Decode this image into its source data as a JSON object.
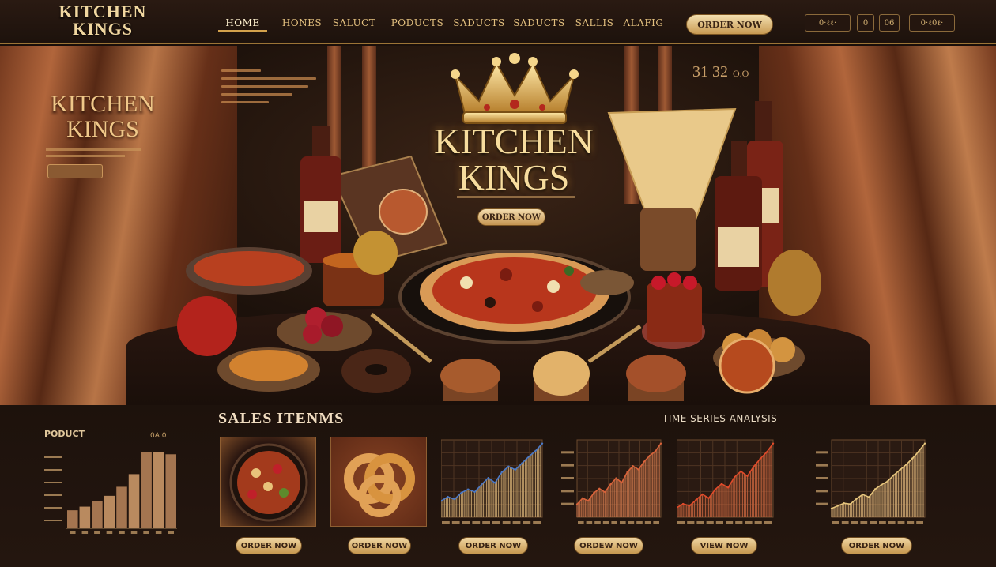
{
  "brand": {
    "logo": "KITCHEN KINGS"
  },
  "nav": {
    "items": [
      "HOME",
      "HONES",
      "SALUCT",
      "PODUCTS",
      "SADUCTS",
      "SADUCTS",
      "SALLIS",
      "ALAFIG"
    ],
    "active_index": 0,
    "order_label": "ORDER NOW"
  },
  "utility": {
    "a": "0·ℓℓ·",
    "b": "0",
    "c": "06",
    "d": "0·ℓ0ℓ·"
  },
  "hero": {
    "left_title": "KITCHEN KINGS",
    "title": "KITCHEN KINGS",
    "order_label": "ORDER NOW",
    "counter": "31 32",
    "counter_unit": "O.O"
  },
  "sales": {
    "heading": "SALES ITENMS",
    "time_series_heading": "TIME SERIES ANALYSIS",
    "product_label": "PODUCT",
    "product_value": "0A 0",
    "buttons": [
      "ORDER NOW",
      "ORDER NOW",
      "ORDER NOW",
      "ORDEW NOW",
      "VIEW NOW",
      "ORDER NOW"
    ]
  },
  "colors": {
    "gold": "#d4a24c",
    "background": "#1a0f0a",
    "accent": "#c6974f"
  },
  "chart_data": [
    {
      "type": "bar",
      "values": [
        1,
        1.2,
        1.5,
        1.8,
        2.3,
        3,
        4.2,
        4.2,
        4.1
      ]
    },
    {
      "type": "area",
      "values": [
        2,
        2.5,
        2.2,
        3,
        3.4,
        3.1,
        4,
        4.8,
        4.2,
        5.5,
        6.2,
        5.8,
        6.6,
        7.4,
        8.1,
        9
      ]
    },
    {
      "type": "area",
      "values": [
        1.5,
        2.2,
        1.9,
        2.8,
        3.3,
        2.9,
        3.8,
        4.5,
        4,
        5.2,
        5.9,
        5.5,
        6.4,
        7.1,
        7.6,
        8.5
      ]
    },
    {
      "type": "area",
      "values": [
        1,
        1.4,
        1.2,
        1.8,
        2.4,
        2,
        2.9,
        3.5,
        3.1,
        4.2,
        4.8,
        4.3,
        5.3,
        6.1,
        6.8,
        7.7
      ]
    },
    {
      "type": "area",
      "values": [
        1,
        1.3,
        1.6,
        1.5,
        2.1,
        2.6,
        2.3,
        3.2,
        3.7,
        4.1,
        4.8,
        5.4,
        6,
        6.7,
        7.5,
        8.4
      ]
    }
  ]
}
